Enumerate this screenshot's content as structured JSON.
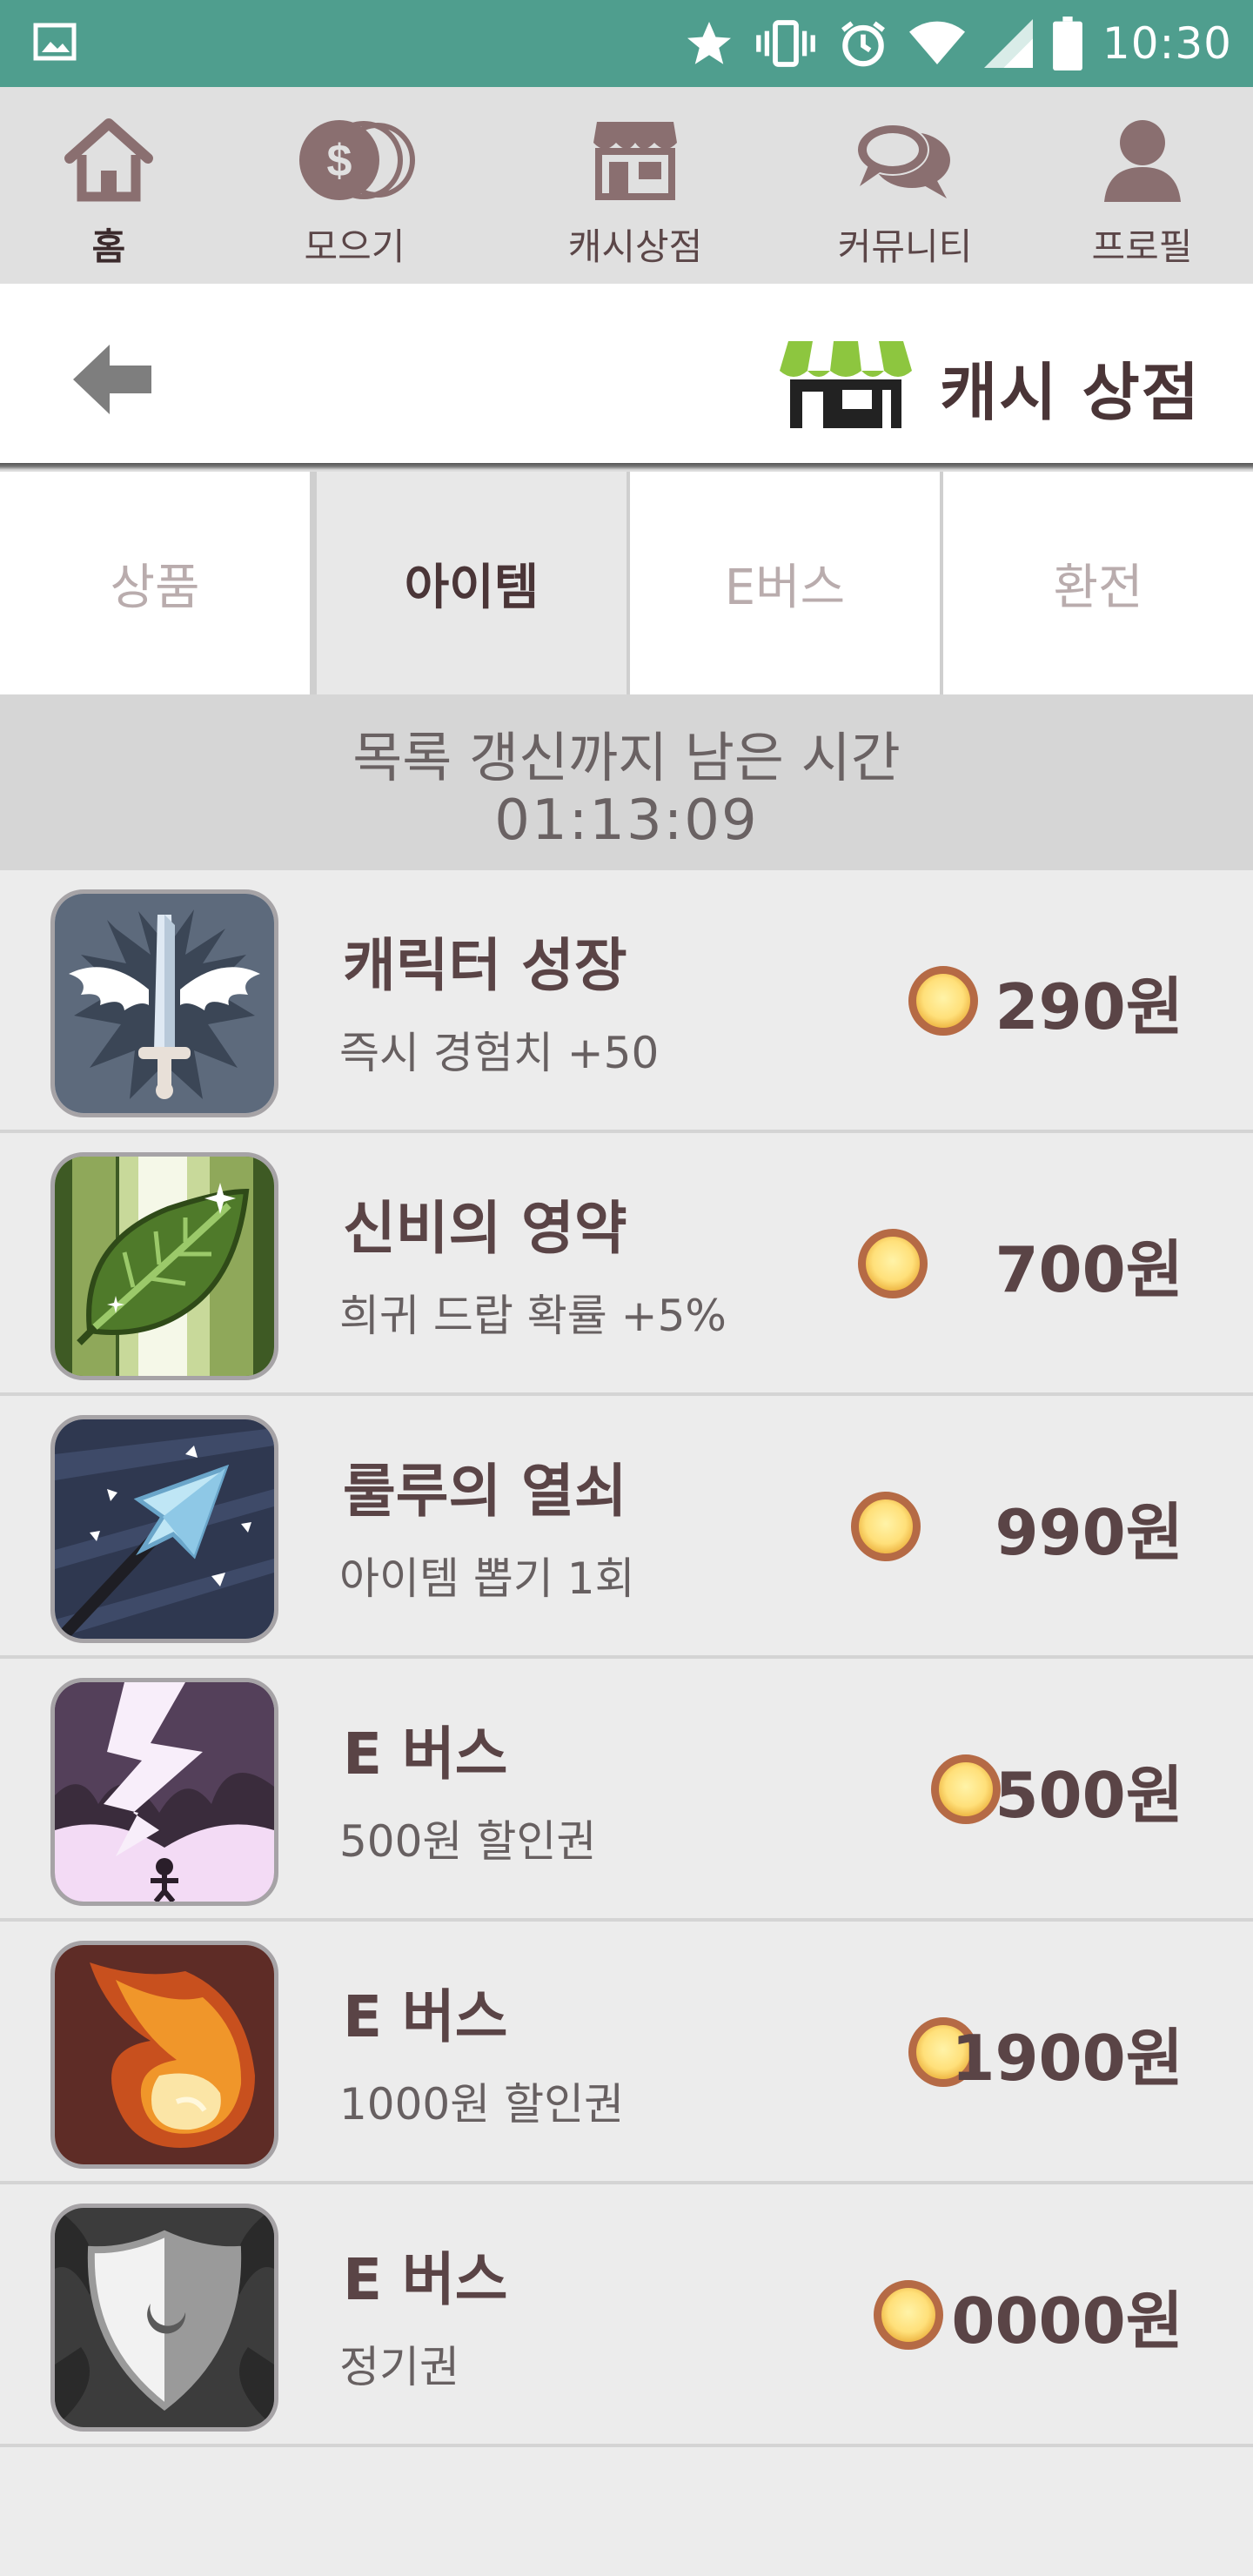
{
  "status_bar": {
    "time": "10:30",
    "icons": [
      "image-icon",
      "star-icon",
      "vibrate-icon",
      "alarm-icon",
      "wifi-icon",
      "signal-icon",
      "battery-icon"
    ],
    "bg_color": "#4f9e8e"
  },
  "nav": {
    "items": [
      {
        "label": "홈",
        "icon": "home-icon",
        "active": true
      },
      {
        "label": "모으기",
        "icon": "coins-icon",
        "active": false
      },
      {
        "label": "캐시상점",
        "icon": "store-icon",
        "active": false
      },
      {
        "label": "커뮤니티",
        "icon": "chat-icon",
        "active": false
      },
      {
        "label": "프로필",
        "icon": "profile-icon",
        "active": false
      }
    ]
  },
  "header": {
    "title": "캐시 상점",
    "back_icon": "back-arrow-icon",
    "title_icon": "shop-icon",
    "accent_color": "#8dc63f"
  },
  "tabs": [
    {
      "label": "상품",
      "active": false
    },
    {
      "label": "아이템",
      "active": true
    },
    {
      "label": "E버스",
      "active": false
    },
    {
      "label": "환전",
      "active": false
    }
  ],
  "timer": {
    "label": "목록 갱신까지 남은 시간",
    "value": "01:13:09"
  },
  "items": [
    {
      "name": "캐릭터 성장",
      "desc": "즉시 경험치 +50",
      "price": "290원",
      "icon": "winged-sword-icon"
    },
    {
      "name": "신비의 영약",
      "desc": "희귀 드랍 확률 +5%",
      "price": "700원",
      "icon": "leaf-icon"
    },
    {
      "name": "룰루의 열쇠",
      "desc": "아이템 뽑기 1회",
      "price": "990원",
      "icon": "arrow-icon"
    },
    {
      "name": "E 버스",
      "desc": "500원 할인권",
      "price": "500원",
      "icon": "lightning-icon"
    },
    {
      "name": "E 버스",
      "desc": "1000원 할인권",
      "price": "1900원",
      "icon": "fire-icon"
    },
    {
      "name": "E 버스",
      "desc": "정기권",
      "price": "0000원",
      "icon": "shield-icon"
    }
  ]
}
